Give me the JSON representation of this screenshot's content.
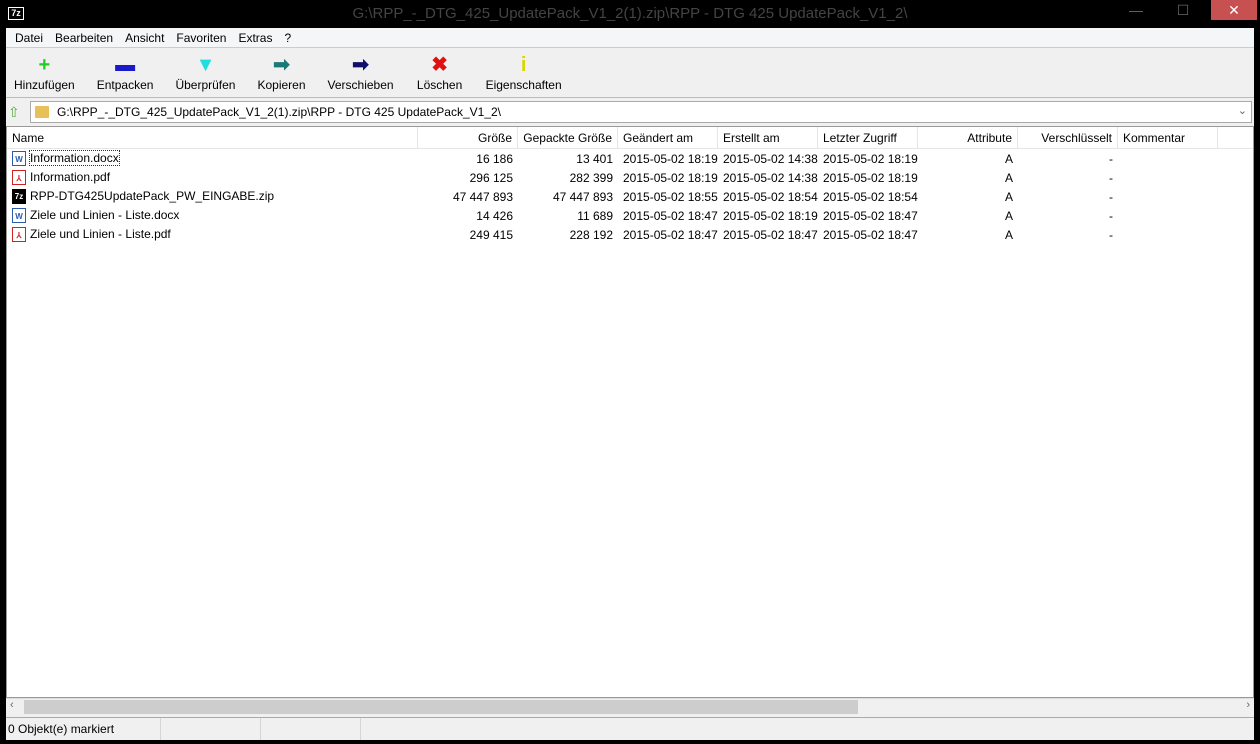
{
  "window": {
    "title": "G:\\RPP_-_DTG_425_UpdatePack_V1_2(1).zip\\RPP - DTG 425 UpdatePack_V1_2\\",
    "logo": "7z",
    "close": "✕",
    "minimize": "—",
    "maximize": "☐"
  },
  "menu": [
    "Datei",
    "Bearbeiten",
    "Ansicht",
    "Favoriten",
    "Extras",
    "?"
  ],
  "toolbar": [
    {
      "label": "Hinzufügen",
      "icon": "+",
      "color": "#22cc22"
    },
    {
      "label": "Entpacken",
      "icon": "▬",
      "color": "#1a1acc"
    },
    {
      "label": "Überprüfen",
      "icon": "▼",
      "color": "#22dddd"
    },
    {
      "label": "Kopieren",
      "icon": "➡",
      "color": "#1a7a7a"
    },
    {
      "label": "Verschieben",
      "icon": "➡",
      "color": "#10106a"
    },
    {
      "label": "Löschen",
      "icon": "✖",
      "color": "#e01010"
    },
    {
      "label": "Eigenschaften",
      "icon": "i",
      "color": "#d8d800"
    }
  ],
  "address": {
    "path": "G:\\RPP_-_DTG_425_UpdatePack_V1_2(1).zip\\RPP - DTG 425 UpdatePack_V1_2\\"
  },
  "columns": [
    "Name",
    "Größe",
    "Gepackte Größe",
    "Geändert am",
    "Erstellt am",
    "Letzter Zugriff",
    "Attribute",
    "Verschlüsselt",
    "Kommentar"
  ],
  "files": [
    {
      "type": "doc",
      "icon": "W",
      "name": "Information.docx",
      "size": "16 186",
      "packed": "13 401",
      "modified": "2015-05-02 18:19",
      "created": "2015-05-02 14:38",
      "accessed": "2015-05-02 18:19",
      "attr": "A",
      "enc": "-",
      "comment": ""
    },
    {
      "type": "pdf",
      "icon": "⅄",
      "name": "Information.pdf",
      "size": "296 125",
      "packed": "282 399",
      "modified": "2015-05-02 18:19",
      "created": "2015-05-02 14:38",
      "accessed": "2015-05-02 18:19",
      "attr": "A",
      "enc": "-",
      "comment": ""
    },
    {
      "type": "zip",
      "icon": "7z",
      "name": "RPP-DTG425UpdatePack_PW_EINGABE.zip",
      "size": "47 447 893",
      "packed": "47 447 893",
      "modified": "2015-05-02 18:55",
      "created": "2015-05-02 18:54",
      "accessed": "2015-05-02 18:54",
      "attr": "A",
      "enc": "-",
      "comment": ""
    },
    {
      "type": "doc",
      "icon": "W",
      "name": "Ziele und Linien - Liste.docx",
      "size": "14 426",
      "packed": "11 689",
      "modified": "2015-05-02 18:47",
      "created": "2015-05-02 18:19",
      "accessed": "2015-05-02 18:47",
      "attr": "A",
      "enc": "-",
      "comment": ""
    },
    {
      "type": "pdf",
      "icon": "⅄",
      "name": "Ziele und Linien - Liste.pdf",
      "size": "249 415",
      "packed": "228 192",
      "modified": "2015-05-02 18:47",
      "created": "2015-05-02 18:47",
      "accessed": "2015-05-02 18:47",
      "attr": "A",
      "enc": "-",
      "comment": ""
    }
  ],
  "status": {
    "selected": "0 Objekt(e) markiert"
  }
}
